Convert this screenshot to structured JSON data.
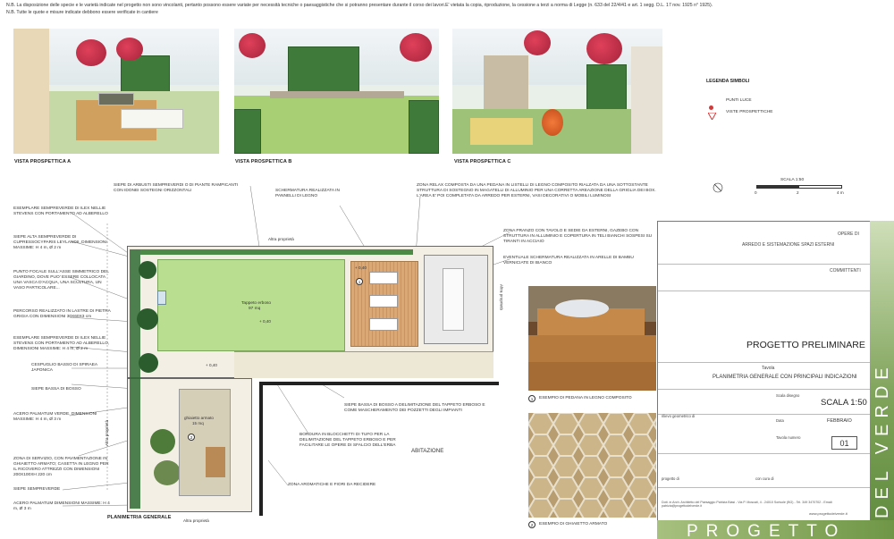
{
  "notes": {
    "line1": "N.B. La disposizione delle specie e le varietà indicate nel progetto non sono vincolanti, pertanto possono essere variate per necessità tecniche o paesaggistiche che si potranno presentare durante il corso dei lavori.E' vietata la copia, riproduzione, la cessione a terzi a norma di Legge (n. 633 del 22/4/41 e art. 1 segg. D.L. 17 nov. 1925 n° 1925).",
    "line2": "N.B. Tutte le quote e misure indicate debbono essere verificate in cantiere"
  },
  "views": [
    {
      "caption": "VISTA PROSPETTICA A"
    },
    {
      "caption": "VISTA PROSPETTICA B"
    },
    {
      "caption": "VISTA PROSPETTICA C"
    }
  ],
  "legend": {
    "title": "LEGENDA SIMBOLI",
    "items": [
      "PUNTI LUCE",
      "VISTE PROSPETTICHE"
    ]
  },
  "scale_bar": {
    "title": "SCALA 1:50",
    "ticks": [
      "0",
      "2",
      "4 m"
    ]
  },
  "labels_left": [
    "ESEMPLARE SEMPREVERDE DI ILEX NELLIE STEVENS CON PORTAMENTO AD ALBERELLO",
    "SIEPE ALTA SEMPREVERDE DI CUPRESSOCYPARIS LEYLANDII, DIMENSIONI MASSIME: H 4 m, Ø 2 m",
    "PUNTO FOCALE SULL'ASSE SIMMETRICO DEL GIARDINO, DOVE PUO' ESSERE COLLOCATA UNA VASCA D'ACQUA, UNA SCULTURA, UN VASO PARTICOLARE...",
    "PERCORSO REALIZZATO IN LASTRE DI PIETRA GRIGIA CON DIMENSIONI 30X60X3 cm",
    "ESEMPLARE SEMPREVERDE DI ILEX NELLIE STEVENS CON PORTAMENTO AD ALBERELLO, DIMENSIONI MASSIME: H 4 m, Ø 2 m",
    "CESPUGLIO BASSO DI SPIRAEA JAPONICA",
    "SIEPE BASSA DI BOSSO",
    "ACERO PALMATUM VERDE, DIMENSIONI MASSIME: H 4 m, Ø 3 m",
    "ZONA DI SERVIZIO, CON PAVIMENTAZIONE IN GHIAIETTO ARMATO; CASETTA IN LEGNO PER IL RICOVERO ATTREZZI CON DIMENSIONI 200X100XH 220 cm",
    "SIEPE SEMPREVERDE",
    "ACERO PALMATUM DIMENSIONI MASSIME: H 4 m, Ø 3 m"
  ],
  "labels_top": [
    "SIEPE DI ARBUSTI SEMPREVERDI O DI PIANTE RAMPICANTI CON IDONEI SOSTEGNI ORIZZONTALI",
    "SCHERMATURA REALIZZATA IN PANNELLI DI LEGNO",
    "ZONA RELAX COMPOSTA DA UNA PEDANA IN LISTELLI DI LEGNO COMPOSITO RIALZATA DA UNA SOTTOSTANTE STRUTTURA DI SOSTEGNO IN MAGATELLI DI ALLUMINIO PER UNA CORRETTA AREAZIONE DELLA GRIGLIA DEI BOX. L'AREA E' POI COMPLETATA DA ARREDO PER ESTERNI, VASI DECORATIVI O MOBILI LUMINOSI",
    "ZONA PRANZO CON TAVOLO E SEDIE DA ESTERNI, GAZEBO CON STRUTTURA IN ALLUMINIO E COPERTURA IN TELI BIANCHI SOSPESI SU TIRANTI IN ACCIAIO",
    "EVENTUALE SCHERMATURA REALIZZATA IN ARELLE DI BAMBU VERNICIATE DI BIANCO"
  ],
  "labels_bottom": [
    "SIEPE BASSA DI BOSSO A DELIMITAZIONE DEL TAPPETO ERBOSO E COME MASCHERAMENTO DEI POZZETTI DEGLI IMPIANTI",
    "BORDURA IN BLOCCHETTI DI TUFO PER LA DELIMITAZIONE DEL TAPPETO ERBOSO E PER FACILITARE LE OPERE DI SFALCIO DELL'ERBA",
    "ZONA AROMATICHE E FIORI DA RECIDERE"
  ],
  "plan": {
    "title": "PLANIMETRIA GENERALE",
    "lawn_label": "Tappeto erboso",
    "lawn_area": "97 mq",
    "gravel_label": "ghiaietto armato",
    "gravel_area": "15 mq",
    "house_label": "ABITAZIONE",
    "property_top": "Altra proprietà",
    "property_bottom": "Altra proprietà",
    "property_left": "Altra proprietà",
    "property_right": "Altra proprietà",
    "level_1": "+ 0,40",
    "level_2": "+ 0,40",
    "level_3": "+ 0,40",
    "marker_1": "1",
    "marker_2": "2"
  },
  "examples": [
    {
      "number": "1",
      "caption": "ESEMPIO DI PEDANA IN LEGNO COMPOSITO"
    },
    {
      "number": "2",
      "caption": "ESEMPIO DI GHIAIETTO ARMATO"
    }
  ],
  "title_block": {
    "opere_label": "OPERE DI",
    "opere_value": "ARREDO E SISTEMAZIONE SPAZI ESTERNI",
    "committenti_label": "COMMITTENTI",
    "project_type": "PROGETTO PRELIMINARE",
    "tavola_label": "Tavola",
    "tavola_value": "PLANIMETRIA GENERALE CON PRINCIPALI INDICAZIONI",
    "scala_label": "Scala disegno",
    "scala_value": "SCALA 1:50",
    "rilievo_label": "rilievo geometrico di",
    "data_label": "Data",
    "data_value": "FEBBRAIO",
    "numero_label": "Tavola numero",
    "numero_value": "01",
    "progetto_label": "progetto di",
    "cura_label": "con cura di",
    "address": "Dott. in Arch. Architetto del Paesaggio Patrizia Biasi - Via P. Moscati, 4 - 24010 Sorisole (BG) - Tel. 349 3470702 - Email: patrizia@progettodelverde.it",
    "website": "www.progettodelverde.it"
  },
  "brand": {
    "vertical": "DEL VERDE",
    "horizontal": "PROGETTO"
  }
}
